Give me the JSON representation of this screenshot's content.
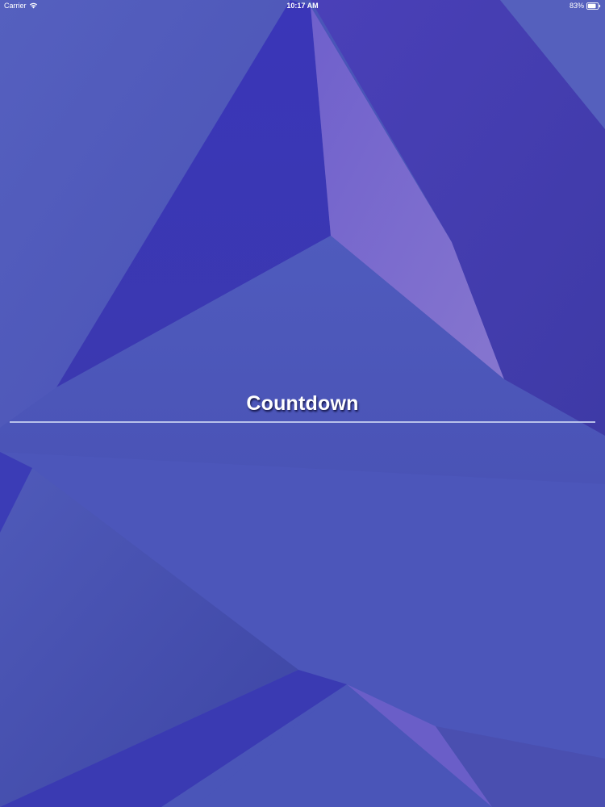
{
  "status_bar": {
    "carrier": "Carrier",
    "time": "10:17 AM",
    "battery": "83%",
    "battery_level": 0.83
  },
  "main": {
    "title": "Countdown"
  },
  "colors": {
    "background": "#4a55b8",
    "title_text": "#ffffff",
    "divider": "#c4cdf0"
  },
  "icons": {
    "wifi": "wifi-icon",
    "battery": "battery-icon"
  }
}
